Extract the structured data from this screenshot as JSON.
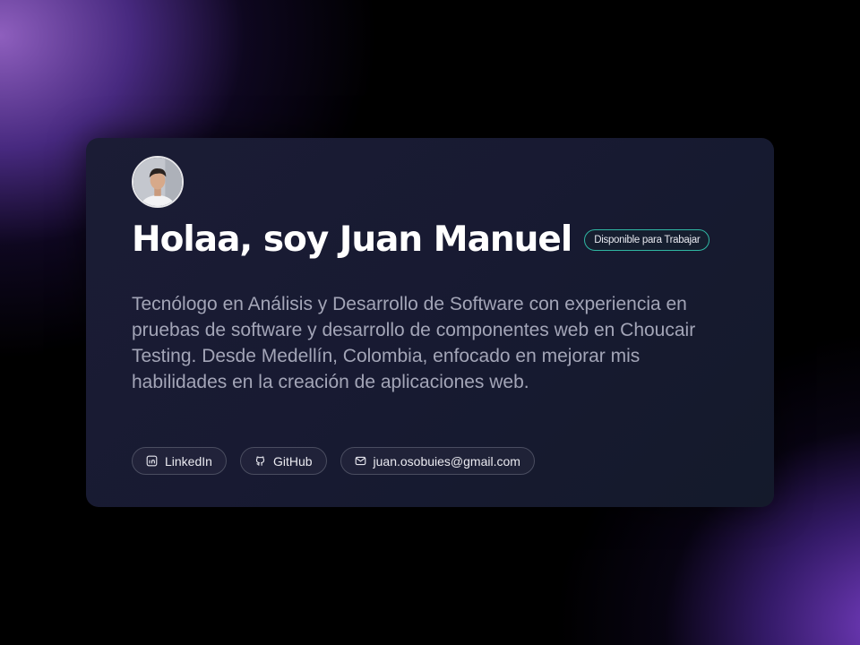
{
  "profile": {
    "avatar_alt": "Juan Manuel",
    "title": "Holaa, soy Juan Manuel",
    "badge": "Disponible para Trabajar",
    "description": "Tecnólogo en Análisis y Desarrollo de Software con experiencia en pruebas de software y desarrollo de componentes web en Choucair Testing. Desde Medellín, Colombia, enfocado en mejorar mis habilidades en la creación de aplicaciones web."
  },
  "links": [
    {
      "label": "LinkedIn",
      "icon": "linkedin-icon"
    },
    {
      "label": "GitHub",
      "icon": "github-icon"
    },
    {
      "label": "juan.osobuies@gmail.com",
      "icon": "mail-icon"
    }
  ],
  "colors": {
    "card_background": "#171a31",
    "badge_border": "#2fb7a3",
    "accent_purple": "#7b42cc"
  }
}
